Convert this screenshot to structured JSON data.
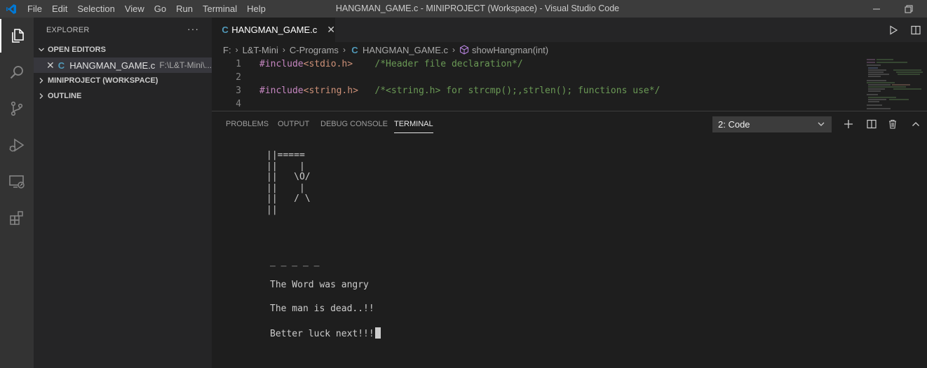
{
  "titlebar": {
    "menu": [
      "File",
      "Edit",
      "Selection",
      "View",
      "Go",
      "Run",
      "Terminal",
      "Help"
    ],
    "title": "HANGMAN_GAME.c - MINIPROJECT (Workspace) - Visual Studio Code"
  },
  "activitybar": {
    "icons": [
      "explorer-icon",
      "search-icon",
      "source-control-icon",
      "run-debug-icon",
      "remote-explorer-icon",
      "extensions-icon"
    ]
  },
  "sidebar": {
    "header": "EXPLORER",
    "more": "···",
    "open_editors": "OPEN EDITORS",
    "open_file": {
      "name": "HANGMAN_GAME.c",
      "path": "F:\\L&T-Mini\\..."
    },
    "workspace": "MINIPROJECT (WORKSPACE)",
    "outline": "OUTLINE"
  },
  "editor": {
    "tab": "HANGMAN_GAME.c",
    "breadcrumb": [
      "F:",
      "L&T-Mini",
      "C-Programs",
      "HANGMAN_GAME.c",
      "showHangman(int)"
    ],
    "lines": [
      {
        "num": "1",
        "kw": "#include",
        "inc": "<stdio.h>",
        "gap": "    ",
        "comment": "/*Header file declaration*/"
      },
      {
        "num": "2",
        "kw": "",
        "inc": "",
        "gap": "",
        "comment": ""
      },
      {
        "num": "3",
        "kw": "#include",
        "inc": "<string.h>",
        "gap": "   ",
        "comment": "/*<string.h> for strcmp();,strlen(); functions use*/"
      },
      {
        "num": "4",
        "kw": "",
        "inc": "",
        "gap": "",
        "comment": ""
      }
    ]
  },
  "panel": {
    "tabs": [
      "PROBLEMS",
      "OUTPUT",
      "DEBUG CONSOLE",
      "TERMINAL"
    ],
    "active_tab": "TERMINAL",
    "terminal_select": "2: Code"
  },
  "terminal": {
    "hangman": "||=====\n||    |\n||   \\O/\n||    |\n||   / \\\n||",
    "word_blanks": "_ _ _ _ _",
    "line1": "The Word was angry",
    "line2": "The man is dead..!!",
    "line3": "Better luck next!!!"
  },
  "colors": {
    "titlebar": "#3c3c3c",
    "activitybar": "#333333",
    "sidebar": "#252526",
    "editor": "#1e1e1e",
    "accent_blue": "#0078d4",
    "c_file": "#519aba"
  }
}
